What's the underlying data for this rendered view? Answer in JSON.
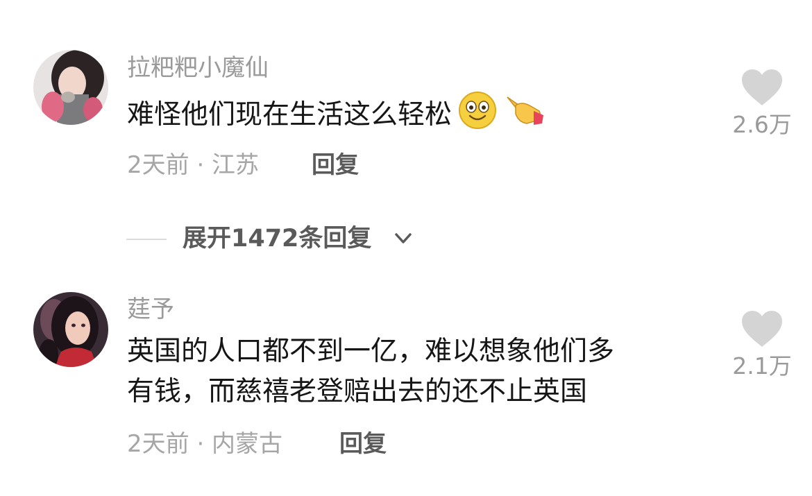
{
  "comments": [
    {
      "username": "拉粑粑小魔仙",
      "text": "难怪他们现在生活这么轻松",
      "emojis": [
        "smiling-face-emoji",
        "pointing-finger-emoji"
      ],
      "time": "2天前",
      "location": "江苏",
      "meta": "2天前 · 江苏",
      "reply_label": "回复",
      "like_count": "2.6万"
    },
    {
      "username": "莛予",
      "text_line1": "英国的人口都不到一亿，难以想象他们多",
      "text_line2": "有钱，而慈禧老登赔出去的还不止英国",
      "time": "2天前",
      "location": "内蒙古",
      "meta": "2天前 · 内蒙古",
      "reply_label": "回复",
      "like_count": "2.1万"
    }
  ],
  "expand_replies": {
    "label": "展开1472条回复"
  },
  "colors": {
    "username": "#9a9a9a",
    "comment_text": "#161616",
    "heart": "#d4d4d4",
    "reply": "#5a5a5a"
  }
}
